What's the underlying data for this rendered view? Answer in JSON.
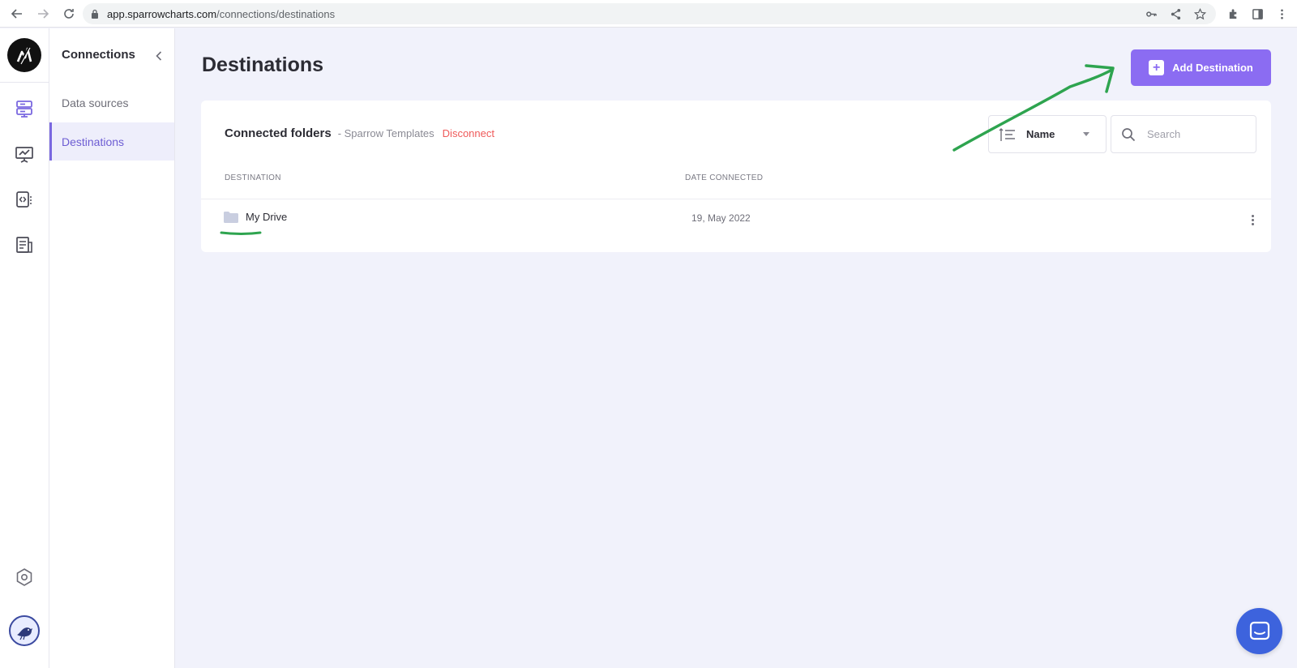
{
  "browser": {
    "url_host": "app.sparrowcharts.com",
    "url_path": "/connections/destinations"
  },
  "rail": {
    "icons": [
      "data-sources-icon",
      "presentation-chart-icon",
      "code-embed-icon",
      "report-document-icon",
      "settings-hexagon-icon"
    ]
  },
  "subnav": {
    "title": "Connections",
    "items": [
      {
        "label": "Data sources",
        "active": false
      },
      {
        "label": "Destinations",
        "active": true
      }
    ]
  },
  "main": {
    "title": "Destinations",
    "add_button_label": "Add Destination",
    "card": {
      "title": "Connected folders",
      "account": "- Sparrow Templates",
      "disconnect_label": "Disconnect",
      "sort_label": "Name",
      "search_placeholder": "Search",
      "columns": [
        "DESTINATION",
        "DATE CONNECTED"
      ],
      "rows": [
        {
          "destination": "My Drive",
          "date_connected": "19, May 2022"
        }
      ]
    }
  },
  "colors": {
    "accent": "#8b6cf2",
    "active_nav": "#6d5dd3",
    "disconnect": "#ef5a5a",
    "annotation": "#2ea44f",
    "chat": "#3d63dd"
  }
}
